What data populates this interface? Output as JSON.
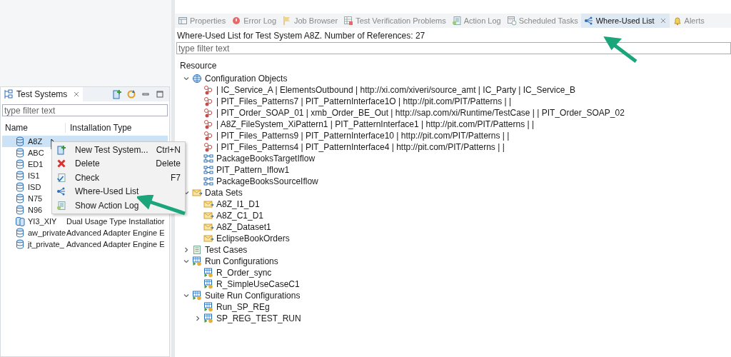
{
  "test_systems": {
    "title": "Test Systems",
    "filter": {
      "placeholder": "type filter text"
    },
    "columns": [
      "Name",
      "Installation Type"
    ],
    "rows": [
      {
        "name": "A8Z",
        "kind": "single",
        "selected": true
      },
      {
        "name": "ABC",
        "kind": "single",
        "selected": false
      },
      {
        "name": "ED1",
        "kind": "single",
        "selected": false
      },
      {
        "name": "IS1",
        "kind": "single",
        "selected": false
      },
      {
        "name": "ISD",
        "kind": "single",
        "selected": false
      },
      {
        "name": "N75",
        "kind": "single",
        "selected": false
      },
      {
        "name": "N96",
        "kind": "single",
        "selected": false
      },
      {
        "name": "YI3_XIY",
        "type": "Dual Usage Type Installatior",
        "kind": "dual",
        "selected": false
      },
      {
        "name": "aw_private",
        "type": "Advanced Adapter Engine E",
        "kind": "single",
        "selected": false
      },
      {
        "name": "jt_private_",
        "type": "Advanced Adapter Engine E",
        "kind": "single",
        "selected": false
      }
    ]
  },
  "context_menu": [
    {
      "label": "New Test System...",
      "shortcut": "Ctrl+N",
      "kind": "new"
    },
    {
      "label": "Delete",
      "shortcut": "Delete",
      "kind": "delete"
    },
    {
      "label": "Check",
      "shortcut": "F7",
      "kind": "check"
    },
    {
      "label": "Where-Used List",
      "kind": "where-used"
    },
    {
      "label": "Show Action Log",
      "kind": "log"
    }
  ],
  "tabs": [
    {
      "label": "Properties",
      "kind": "properties",
      "selected": false
    },
    {
      "label": "Error Log",
      "kind": "error",
      "selected": false
    },
    {
      "label": "Job Browser",
      "kind": "job",
      "selected": false
    },
    {
      "label": "Test Verification Problems",
      "kind": "problems",
      "selected": false
    },
    {
      "label": "Action Log",
      "kind": "log",
      "selected": false
    },
    {
      "label": "Scheduled Tasks",
      "kind": "scheduled",
      "selected": false
    },
    {
      "label": "Where-Used List",
      "kind": "where-used",
      "selected": true
    },
    {
      "label": "Alerts",
      "kind": "alerts",
      "selected": false
    }
  ],
  "heading": "Where-Used List for Test System A8Z. Number of References: 27",
  "filter": {
    "placeholder": "type filter text"
  },
  "column": "Resource",
  "tree": [
    {
      "label": "Configuration Objects",
      "kind": "config",
      "expanded": true,
      "children": [
        {
          "label": "| IC_Service_A | ElementsOutbound | http://xi.com/xiveri/source_amt | IC_Party | IC_Service_B",
          "kind": "mapping"
        },
        {
          "label": "| PIT_Files_Patterns7 | PIT_PatternInterface1O | http://pit.com/PIT/Patterns |  |",
          "kind": "mapping"
        },
        {
          "label": "| PIT_Order_SOAP_01 | xmb_Order_BE_Out | http://sap.com/xi/Runtime/TestCase |  | PIT_Order_SOAP_02",
          "kind": "mapping"
        },
        {
          "label": "| A8Z_FileSystem_XiPattern1 | PIT_PatternInterface1 | http://pit.com/PIT/Patterns |  |",
          "kind": "mapping"
        },
        {
          "label": "| PIT_Files_Patterns9 | PIT_PatternInterface10 | http://pit.com/PIT/Patterns |  |",
          "kind": "mapping"
        },
        {
          "label": "| PIT_Files_Patterns4 | PIT_PatternInterface4 | http://pit.com/PIT/Patterns |  |",
          "kind": "mapping"
        },
        {
          "label": "PackageBooksTargetIflow",
          "kind": "iflow"
        },
        {
          "label": "PIT_Pattern_Iflow1",
          "kind": "iflow"
        },
        {
          "label": "PackageBooksSourceIflow",
          "kind": "iflow"
        }
      ]
    },
    {
      "label": "Data Sets",
      "kind": "dataset",
      "expanded": true,
      "children": [
        {
          "label": "A8Z_I1_D1",
          "kind": "dataset"
        },
        {
          "label": "A8Z_C1_D1",
          "kind": "dataset"
        },
        {
          "label": "A8Z_Dataset1",
          "kind": "dataset"
        },
        {
          "label": "EclipseBookOrders",
          "kind": "dataset"
        }
      ]
    },
    {
      "label": "Test Cases",
      "kind": "testcases",
      "expanded": false
    },
    {
      "label": "Run Configurations",
      "kind": "run",
      "expanded": true,
      "children": [
        {
          "label": "R_Order_sync",
          "kind": "run"
        },
        {
          "label": "R_SimpleUseCaseC1",
          "kind": "run"
        }
      ]
    },
    {
      "label": "Suite Run Configurations",
      "kind": "run",
      "expanded": true,
      "children": [
        {
          "label": "Run_SP_REg",
          "kind": "run"
        },
        {
          "label": "SP_REG_TEST_RUN",
          "kind": "run",
          "expanded": false
        }
      ]
    }
  ]
}
